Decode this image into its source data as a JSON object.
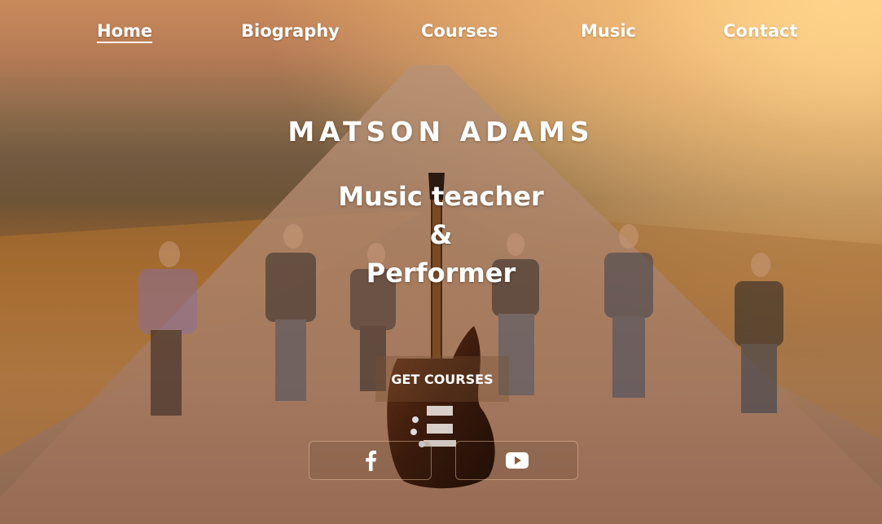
{
  "nav": {
    "items": [
      {
        "label": "Home",
        "active": true
      },
      {
        "label": "Biography",
        "active": false
      },
      {
        "label": "Courses",
        "active": false
      },
      {
        "label": "Music",
        "active": false
      },
      {
        "label": "Contact",
        "active": false
      }
    ]
  },
  "hero": {
    "name": "MATSON ADAMS",
    "tagline_line1": "Music teacher",
    "tagline_line2": "&",
    "tagline_line3": "Performer",
    "cta_label": "GET COURSES"
  },
  "social": {
    "facebook_icon": "facebook-icon",
    "youtube_icon": "youtube-icon"
  },
  "colors": {
    "text": "#ffffff",
    "accent_border": "#e0b494"
  }
}
